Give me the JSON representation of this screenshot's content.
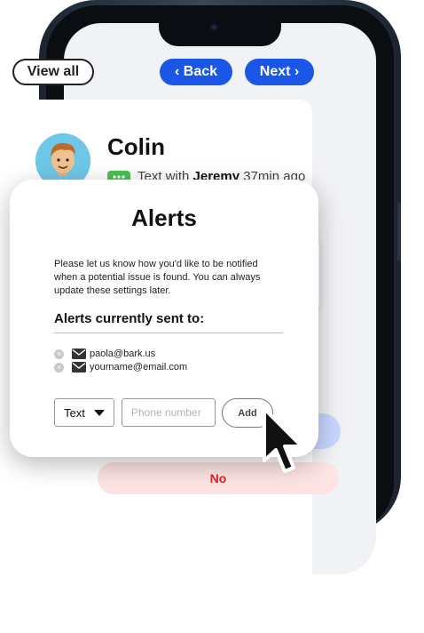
{
  "header": {
    "view_all_label": "View all",
    "back_label": "‹ Back",
    "next_label": "Next ›"
  },
  "contact": {
    "name": "Colin",
    "activity_prefix": "Text with ",
    "activity_person": "Jeremy",
    "activity_time": " 37min ago",
    "message_icon": "message-bubble-icon",
    "avatar_icon": "cartoon-person-icon"
  },
  "actions": {
    "no_label": "No"
  },
  "alerts_modal": {
    "title": "Alerts",
    "description": "Please let us know how you'd like to be notified when a potential issue is found. You can always update these settings later.",
    "recipients_heading": "Alerts currently sent to:",
    "recipients": [
      {
        "address": "paola@bark.us"
      },
      {
        "address": "yourname@email.com"
      }
    ],
    "type_select_value": "Text",
    "phone_placeholder": "Phone number",
    "add_label": "Add"
  },
  "colors": {
    "primary_blue": "#1a57e6",
    "no_button_bg": "#fde3e3",
    "no_button_text": "#e02424",
    "message_badge": "#4cc154"
  }
}
